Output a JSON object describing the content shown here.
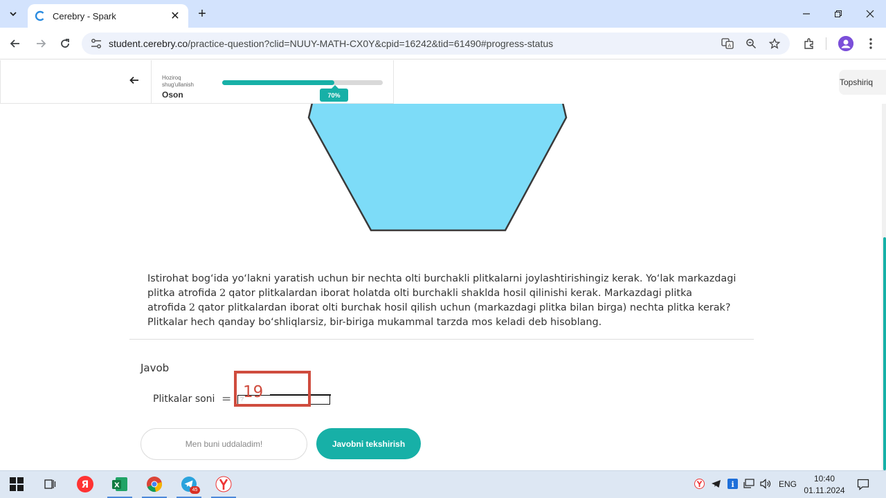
{
  "browser": {
    "tab_title": "Cerebry - Spark",
    "url_host": "student.cerebry.co",
    "url_rest": "/practice-question?clid=NUUY-MATH-CX0Y&cpid=16242&tid=61490#progress-status"
  },
  "header": {
    "practice_label": "Hoziroq shug'ullanish",
    "level_value": "Oson",
    "progress_value": 0.7,
    "progress_label": "70%",
    "task_button": "Topshiriq"
  },
  "question": {
    "part1": "Istirohat bog‘ida yo‘lakni yaratish uchun bir nechta olti burchakli plitkalarni joylashtirishingiz kerak. Yo‘lak markazdagi plitka atrofida",
    "n1": "2",
    "part2": "qator plitkalardan iborat holatda olti burchakli shaklda hosil qilinishi kerak. Markazdagi plitka atrofida",
    "n2": "2",
    "part3": "qator plitkalardan iborat olti burchak hosil qilish uchun (markazdagi plitka bilan birga) nechta plitka kerak? Plitkalar hech qanday bo‘shliqlarsiz, bir-biriga mukammal tarzda mos keladi deb hisoblang."
  },
  "answer": {
    "label": "Javob",
    "field_label": "Plitkalar soni",
    "equals": "=",
    "placeholder": "?",
    "annotation_value": "19"
  },
  "buttons": {
    "done": "Men buni uddaladim!",
    "check": "Javobni tekshirish"
  },
  "taskbar": {
    "telegram_badge": "45",
    "lang": "ENG",
    "time": "10:40",
    "date": "01.11.2024"
  },
  "colors": {
    "accent": "#17b0a7",
    "hexagon_fill": "#7ddcf8",
    "annotation": "#cf4c3e"
  }
}
